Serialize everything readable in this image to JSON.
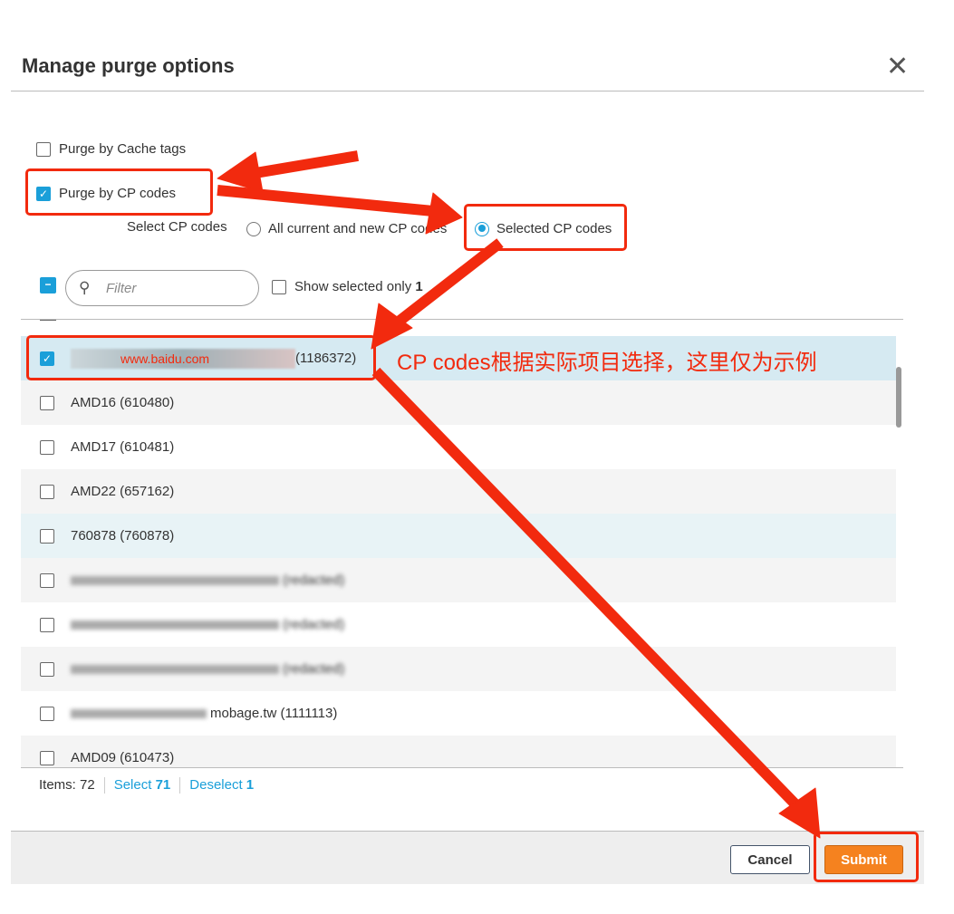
{
  "dialog": {
    "title": "Manage purge options",
    "close_icon": "close-icon"
  },
  "options": {
    "cache_tags": {
      "label": "Purge by Cache tags",
      "checked": false
    },
    "cp_codes": {
      "label": "Purge by CP codes",
      "checked": true
    },
    "select_label": "Select CP codes",
    "radio_all": {
      "label": "All current and new CP codes",
      "selected": false
    },
    "radio_selected": {
      "label": "Selected CP codes",
      "selected": true
    }
  },
  "toolbar": {
    "filter_placeholder": "Filter",
    "show_selected_label": "Show selected only",
    "show_selected_count": "1"
  },
  "rows": [
    {
      "label": "(1186372)",
      "checked": true,
      "overlay": "www.baidu.com"
    },
    {
      "label": "AMD16 (610480)",
      "checked": false
    },
    {
      "label": "AMD17 (610481)",
      "checked": false
    },
    {
      "label": "AMD22 (657162)",
      "checked": false
    },
    {
      "label": "760878 (760878)",
      "checked": false
    },
    {
      "label": "(redacted)",
      "checked": false
    },
    {
      "label": "(redacted)",
      "checked": false
    },
    {
      "label": "(redacted)",
      "checked": false
    },
    {
      "label": "mobage.tw (1111113)",
      "checked": false
    },
    {
      "label": "AMD09 (610473)",
      "checked": false
    }
  ],
  "summary": {
    "items_label": "Items: 72",
    "select_label": "Select",
    "select_count": "71",
    "deselect_label": "Deselect",
    "deselect_count": "1"
  },
  "footer": {
    "cancel": "Cancel",
    "submit": "Submit"
  },
  "annotation": {
    "note": "CP codes根据实际项目选择，这里仅为示例",
    "color": "#f22a0e"
  },
  "colors": {
    "accent": "#1a9fd9",
    "submit": "#f5821f",
    "selected_row": "#d6eaf2"
  }
}
